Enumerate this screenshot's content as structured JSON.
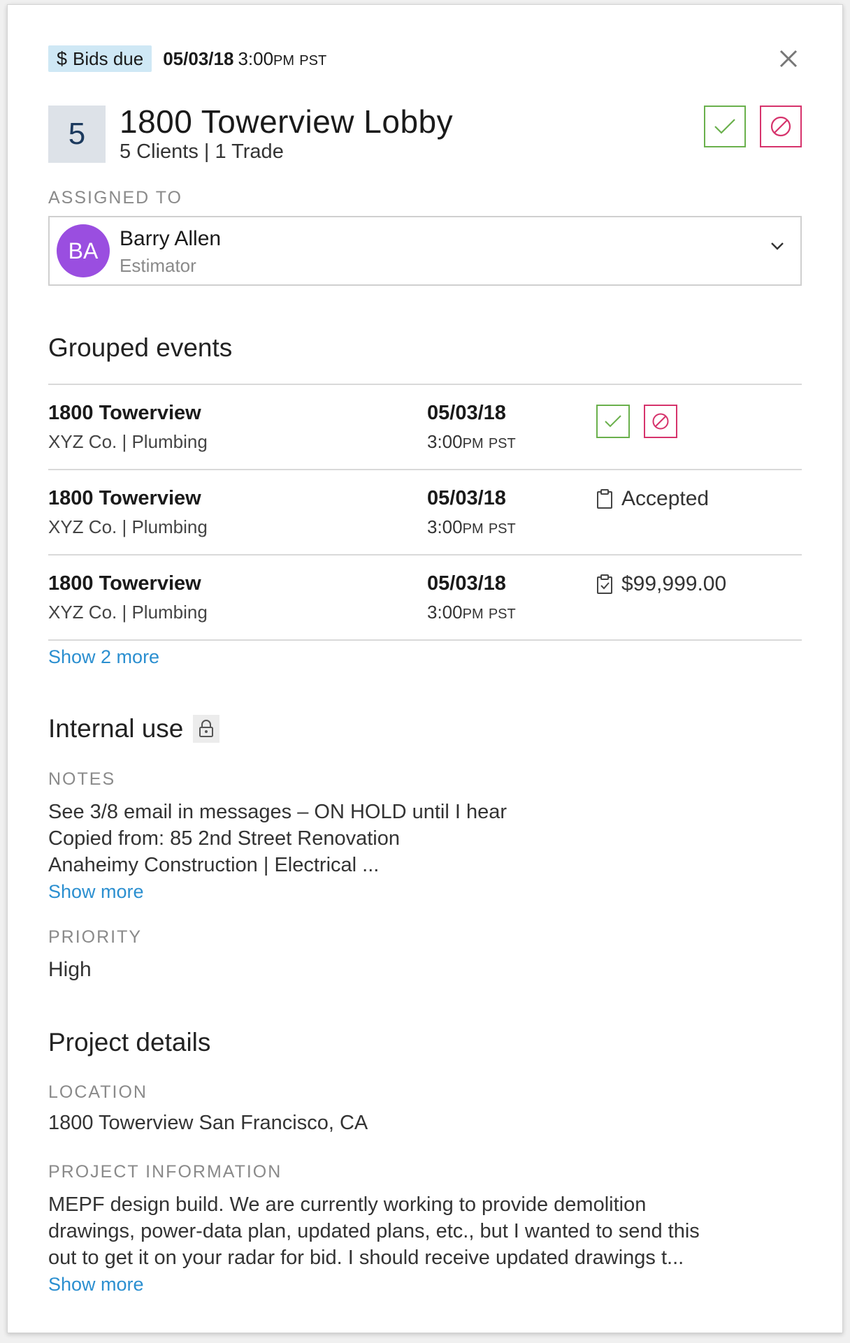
{
  "header": {
    "badge_symbol": "$",
    "badge_label": "Bids due",
    "date": "05/03/18",
    "time": "3:00",
    "ampm": "PM",
    "tz": "PST"
  },
  "project": {
    "count": "5",
    "title": "1800 Towerview Lobby",
    "subtitle": "5 Clients  |  1 Trade"
  },
  "assigned": {
    "label": "ASSIGNED TO",
    "initials": "BA",
    "name": "Barry Allen",
    "role": "Estimator",
    "avatar_color": "#9a4ee0"
  },
  "grouped": {
    "title": "Grouped events",
    "events": [
      {
        "name": "1800 Towerview",
        "sub": "XYZ Co.  |  Plumbing",
        "date": "05/03/18",
        "time": "3:00",
        "ampm": "PM",
        "tz": "PST",
        "status": ""
      },
      {
        "name": "1800 Towerview",
        "sub": "XYZ Co.  |  Plumbing",
        "date": "05/03/18",
        "time": "3:00",
        "ampm": "PM",
        "tz": "PST",
        "status": "Accepted"
      },
      {
        "name": "1800 Towerview",
        "sub": "XYZ Co.  |  Plumbing",
        "date": "05/03/18",
        "time": "3:00",
        "ampm": "PM",
        "tz": "PST",
        "status": "$99,999.00"
      }
    ],
    "show_more": "Show 2 more"
  },
  "internal": {
    "title": "Internal use",
    "notes_label": "NOTES",
    "notes": [
      "See 3/8 email in messages – ON HOLD until I hear",
      "Copied from: 85 2nd Street Renovation",
      "Anaheimy Construction  |  Electrical ..."
    ],
    "show_more": "Show more",
    "priority_label": "PRIORITY",
    "priority": "High"
  },
  "details": {
    "title": "Project details",
    "location_label": "LOCATION",
    "location": "1800 Towerview San Francisco, CA",
    "info_label": "PROJECT INFORMATION",
    "info": [
      "MEPF design build. We are currently working to provide demolition",
      "drawings, power-data plan, updated plans, etc., but I wanted to send this",
      "out to get it on your radar for bid. I should receive updated drawings t..."
    ],
    "show_more": "Show more"
  },
  "colors": {
    "accept": "#6ab04c",
    "decline": "#d6336c",
    "link": "#2b8fd0",
    "badge_bg": "#cfe8f5"
  }
}
